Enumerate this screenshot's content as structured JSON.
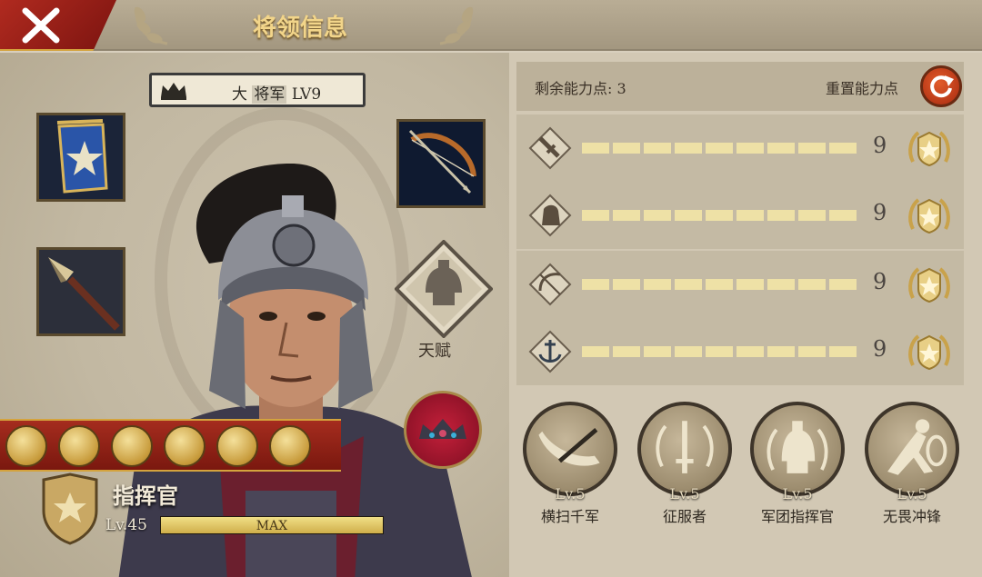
{
  "header": {
    "title": "将领信息"
  },
  "rank": {
    "prefix": "大",
    "title": "将军",
    "level": "LV9"
  },
  "talent": {
    "label": "天赋"
  },
  "commander": {
    "title": "指挥官",
    "level": "Lv.45",
    "xp_label": "MAX",
    "xp_progress": 1.0
  },
  "ability_points": {
    "label": "剩余能力点:",
    "value": "3",
    "reset_label": "重置能力点"
  },
  "attributes": [
    {
      "icon": "sword-icon",
      "value": "9"
    },
    {
      "icon": "horse-icon",
      "value": "9"
    },
    {
      "icon": "bow-icon",
      "value": "9"
    },
    {
      "icon": "anchor-icon",
      "value": "9"
    }
  ],
  "abilities": [
    {
      "name": "横扫千军",
      "level": "Lv.5",
      "icon": "slash-icon"
    },
    {
      "name": "征服者",
      "level": "Lv.5",
      "icon": "laurel-sword-icon"
    },
    {
      "name": "军团指挥官",
      "level": "Lv.5",
      "icon": "helmet-laurel-icon"
    },
    {
      "name": "无畏冲锋",
      "level": "Lv.5",
      "icon": "charging-soldier-icon"
    }
  ],
  "equipment": [
    {
      "icon": "banner-icon"
    },
    {
      "icon": "bow-arrow-icon"
    },
    {
      "icon": "spear-icon"
    }
  ],
  "skill_strip": [
    "skill-1-icon",
    "skill-2-icon",
    "skill-3-icon",
    "skill-4-icon",
    "skill-5-icon",
    "skill-6-icon"
  ],
  "colors": {
    "accent_red": "#a52c1e",
    "gold": "#d4a33d",
    "bar_fill": "#eee1a6"
  }
}
